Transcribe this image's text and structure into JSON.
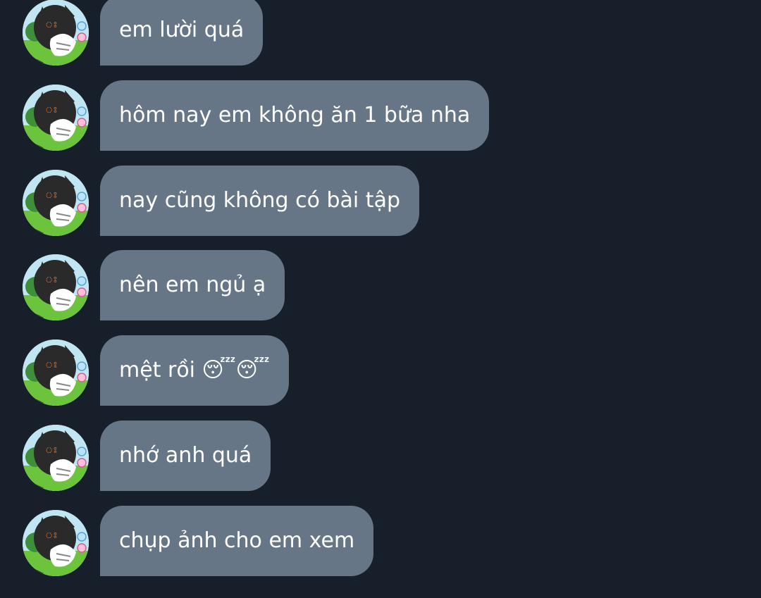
{
  "colors": {
    "background": "#17202a",
    "bubble": "#667686",
    "text": "#ffffff"
  },
  "messages": [
    {
      "text": "em lười quá",
      "avatar_icon": "sleeping-cartoon-avatar-icon"
    },
    {
      "text": "hôm nay em không ăn 1 bữa nha",
      "avatar_icon": "sleeping-cartoon-avatar-icon"
    },
    {
      "text": "nay cũng không có bài tập",
      "avatar_icon": "sleeping-cartoon-avatar-icon"
    },
    {
      "text": "nên em ngủ ạ",
      "avatar_icon": "sleeping-cartoon-avatar-icon"
    },
    {
      "text": "mệt rồi 😴😴",
      "avatar_icon": "sleeping-cartoon-avatar-icon"
    },
    {
      "text": "nhớ anh quá",
      "avatar_icon": "sleeping-cartoon-avatar-icon"
    },
    {
      "text": "chụp ảnh cho em xem",
      "avatar_icon": "sleeping-cartoon-avatar-icon"
    }
  ]
}
